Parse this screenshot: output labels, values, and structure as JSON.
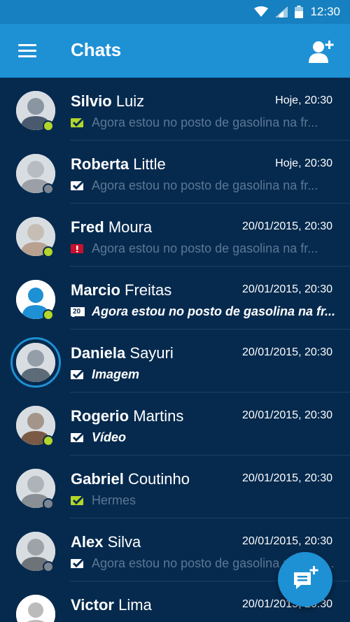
{
  "status_bar": {
    "time": "12:30"
  },
  "app_bar": {
    "title": "Chats"
  },
  "chats": [
    {
      "first": "Silvio",
      "last": "Luiz",
      "time": "Hoje, 20:30",
      "preview": "Agora estou no posto de gasolina na fr...",
      "status": "read",
      "presence": "online",
      "bold": false
    },
    {
      "first": "Roberta",
      "last": "Little",
      "time": "Hoje, 20:30",
      "preview": "Agora estou no posto de gasolina na fr...",
      "status": "sent",
      "presence": "offline",
      "bold": false
    },
    {
      "first": "Fred",
      "last": "Moura",
      "time": "20/01/2015, 20:30",
      "preview": "Agora estou no posto de gasolina na fr...",
      "status": "error",
      "presence": "online",
      "bold": false
    },
    {
      "first": "Marcio",
      "last": "Freitas",
      "time": "20/01/2015, 20:30",
      "preview": "Agora estou no posto de gasolina na fr...",
      "status": "unread",
      "unread_count": "20",
      "presence": "online",
      "bold": true
    },
    {
      "first": "Daniela",
      "last": "Sayuri",
      "time": "20/01/2015, 20:30",
      "preview": "Imagem",
      "status": "sent",
      "presence": "none",
      "bold": true
    },
    {
      "first": "Rogerio",
      "last": "Martins",
      "time": "20/01/2015, 20:30",
      "preview": "Vídeo",
      "status": "sent",
      "presence": "online",
      "bold": true
    },
    {
      "first": "Gabriel",
      "last": "Coutinho",
      "time": "20/01/2015, 20:30",
      "preview": "Hermes",
      "status": "read",
      "presence": "offline",
      "bold": false
    },
    {
      "first": "Alex",
      "last": "Silva",
      "time": "20/01/2015, 20:30",
      "preview": "Agora estou no posto de gasolina na frente de",
      "status": "sent",
      "presence": "offline",
      "bold": false
    },
    {
      "first": "Victor",
      "last": "Lima",
      "time": "20/01/2015, 20:30",
      "preview": "",
      "status": "sent",
      "presence": "none",
      "bold": false
    }
  ],
  "colors": {
    "primary": "#1e90d4",
    "status_bar": "#1680c0",
    "background": "#062a4e",
    "online": "#b4d62a",
    "offline": "#7d8590",
    "error": "#c8102e"
  },
  "icons": {
    "menu": "hamburger-menu-icon",
    "add_contact": "add-person-icon",
    "new_chat": "new-chat-icon"
  }
}
